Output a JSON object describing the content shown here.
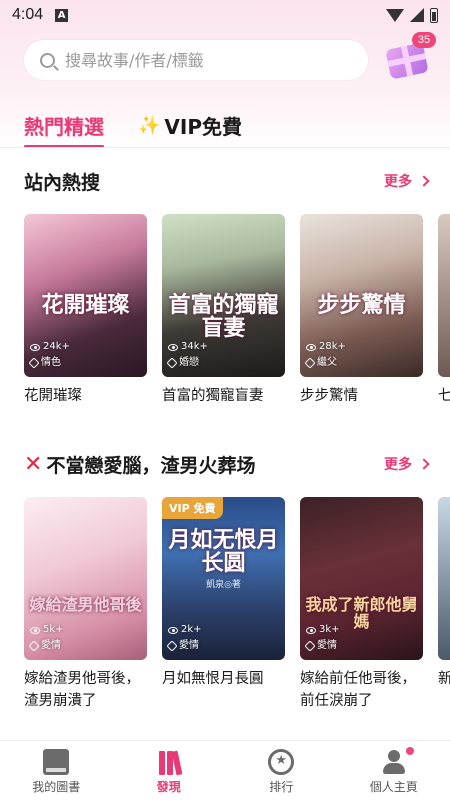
{
  "status_bar": {
    "time": "4:04",
    "indicator": "A"
  },
  "search": {
    "placeholder": "搜尋故事/作者/標籤"
  },
  "gift": {
    "badge_count": "35"
  },
  "tabs": [
    {
      "label": "熱門精選",
      "active": true
    },
    {
      "label": "VIP免費",
      "icon": "sparkle-icon",
      "active": false
    }
  ],
  "sections": [
    {
      "title": "站內熱搜",
      "more_label": "更多",
      "books": [
        {
          "title": "花開璀璨",
          "cover_text": "花開璀璨",
          "views": "24k+",
          "tag": "情色"
        },
        {
          "title": "首富的獨寵盲妻",
          "cover_text": "首富的獨寵盲妻",
          "views": "34k+",
          "tag": "婚戀"
        },
        {
          "title": "步步驚情",
          "cover_text": "步步驚情",
          "views": "28k+",
          "tag": "繼父"
        }
      ],
      "partial_book": {
        "title": "七"
      }
    },
    {
      "title": "不當戀愛腦，渣男火葬场",
      "title_icon": "x-icon",
      "more_label": "更多",
      "books": [
        {
          "title": "嫁給渣男他哥後，渣男崩潰了",
          "cover_text": "嫁給渣男他哥後",
          "views": "5k+",
          "tag": "愛情"
        },
        {
          "title": "月如無恨月長圓",
          "cover_text": "月如无恨月长圆",
          "cover_author": "凱泉◎著",
          "views": "2k+",
          "tag": "愛情",
          "badge": "VIP 免費"
        },
        {
          "title": "嫁給前任他哥後，前任淚崩了",
          "cover_text": "我成了新郎他舅媽",
          "views": "3k+",
          "tag": "愛情"
        }
      ],
      "partial_book": {
        "title": "新"
      }
    }
  ],
  "bottom_nav": [
    {
      "label": "我的圖書",
      "icon": "book-icon",
      "active": false
    },
    {
      "label": "發現",
      "icon": "books-icon",
      "active": true
    },
    {
      "label": "排行",
      "icon": "medal-icon",
      "active": false
    },
    {
      "label": "個人主頁",
      "icon": "user-icon",
      "active": false,
      "has_dot": true
    }
  ],
  "colors": {
    "accent": "#e83a76",
    "vip_gold": "#e7a53a",
    "badge": "#f0457b"
  }
}
